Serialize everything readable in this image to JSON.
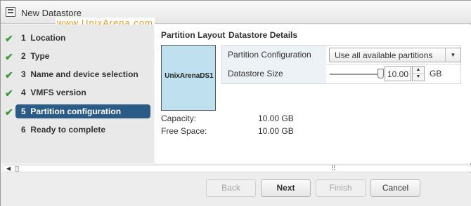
{
  "window": {
    "title": "New Datastore"
  },
  "watermark": "www.UnixArena.com",
  "wizard_steps": [
    {
      "number": "1",
      "label": "Location",
      "completed": true
    },
    {
      "number": "2",
      "label": "Type",
      "completed": true
    },
    {
      "number": "3",
      "label": "Name and device selection",
      "completed": true
    },
    {
      "number": "4",
      "label": "VMFS version",
      "completed": true
    },
    {
      "number": "5",
      "label": "Partition configuration",
      "completed": true,
      "active": true
    },
    {
      "number": "6",
      "label": "Ready to complete",
      "completed": false
    }
  ],
  "partition_layout": {
    "heading": "Partition Layout",
    "datastore_name": "UnixArenaDS1"
  },
  "datastore_details": {
    "heading": "Datastore Details",
    "partition_configuration_label": "Partition Configuration",
    "partition_configuration_value": "Use all available partitions",
    "datastore_size_label": "Datastore Size",
    "datastore_size_value": "10.00",
    "datastore_size_unit": "GB"
  },
  "capacity": {
    "capacity_label": "Capacity:",
    "capacity_value": "10.00 GB",
    "free_space_label": "Free Space:",
    "free_space_value": "10.00 GB"
  },
  "footer": {
    "back_label": "Back",
    "next_label": "Next",
    "finish_label": "Finish",
    "cancel_label": "Cancel"
  },
  "colors": {
    "active_step": "#2a5a86",
    "check": "#3a9a3a",
    "datastore_box": "#bfe0ee"
  }
}
